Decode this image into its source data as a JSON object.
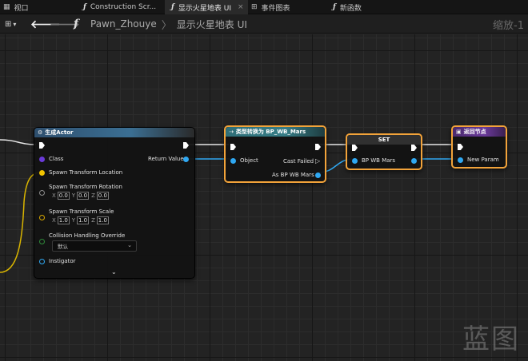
{
  "tabs": [
    {
      "label": "视口",
      "icon": "viewport-icon",
      "active": false
    },
    {
      "label": "Construction Scr...",
      "icon": "function-icon",
      "active": false
    },
    {
      "label": "显示火星地表 UI",
      "icon": "function-icon",
      "active": true,
      "close": "×"
    },
    {
      "label": "事件图表",
      "icon": "grid-icon",
      "active": false
    },
    {
      "label": "新函数",
      "icon": "function-icon",
      "active": false
    }
  ],
  "toolbar": {
    "breadcrumb_root": "Pawn_Zhouye",
    "breadcrumb_current": "显示火星地表 UI",
    "separator": "〉",
    "zoom": "缩放-1",
    "function_glyph": "f"
  },
  "nodes": {
    "spawn_actor": {
      "title": "生成Actor",
      "pins": {
        "class": "Class",
        "return_value": "Return Value",
        "spawn_location": "Spawn Transform Location",
        "spawn_rotation": "Spawn Transform Rotation",
        "spawn_scale": "Spawn Transform Scale",
        "collision": "Collision Handling Override",
        "instigator": "Instigator"
      },
      "rotation": {
        "x": "0.0",
        "y": "0.0",
        "z": "0.0"
      },
      "scale": {
        "x": "1.0",
        "y": "1.0",
        "z": "1.0"
      },
      "axis_labels": {
        "x": "X",
        "y": "Y",
        "z": "Z"
      },
      "collision_value": "默认"
    },
    "cast": {
      "title": "类型转换为 BP_WB_Mars",
      "pins": {
        "object": "Object",
        "cast_failed": "Cast Failed",
        "as_bp": "As BP WB Mars"
      }
    },
    "set": {
      "title": "SET",
      "pins": {
        "bp_wb_mars": "BP WB Mars"
      }
    },
    "return": {
      "title": "返回节点",
      "pins": {
        "new_param": "New Param"
      }
    }
  },
  "watermark": "蓝图",
  "colors": {
    "selection": "#f2a33a",
    "object_pin": "#2fa8f2",
    "class_pin": "#6a3ad8",
    "vector_pin": "#f2c400"
  }
}
